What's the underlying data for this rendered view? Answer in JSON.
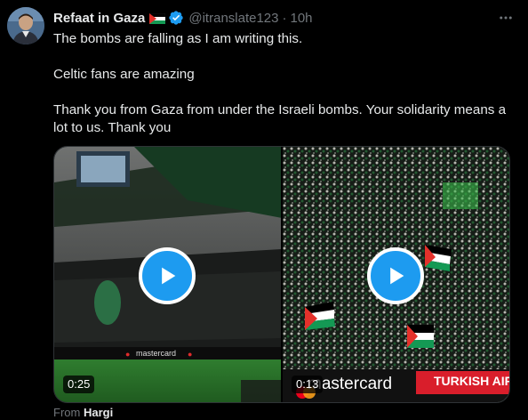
{
  "tweet": {
    "author_name": "Refaat in Gaza",
    "handle": "@itranslate123",
    "separator": "·",
    "time": "10h",
    "lines": [
      "The bombs are falling as I am writing this.",
      "Celtic fans are amazing",
      "Thank you from Gaza from under the Israeli bombs. Your solidarity means a lot to us. Thank you"
    ]
  },
  "media": {
    "videos": [
      {
        "duration": "0:25",
        "banner_text": "mastercard"
      },
      {
        "duration": "0:13",
        "banner_text": "mastercard",
        "banner_text_2": "TURKISH AIR"
      }
    ]
  },
  "attribution": {
    "from_label": "From",
    "source": "Hargi"
  },
  "icons": {
    "flag": "palestine-flag-icon",
    "verified": "verified-badge-icon",
    "more": "more-horizontal-icon",
    "play": "play-icon"
  },
  "colors": {
    "accent": "#1d9bf0",
    "text": "#e7e9ea",
    "muted": "#71767b",
    "background": "#000000"
  }
}
